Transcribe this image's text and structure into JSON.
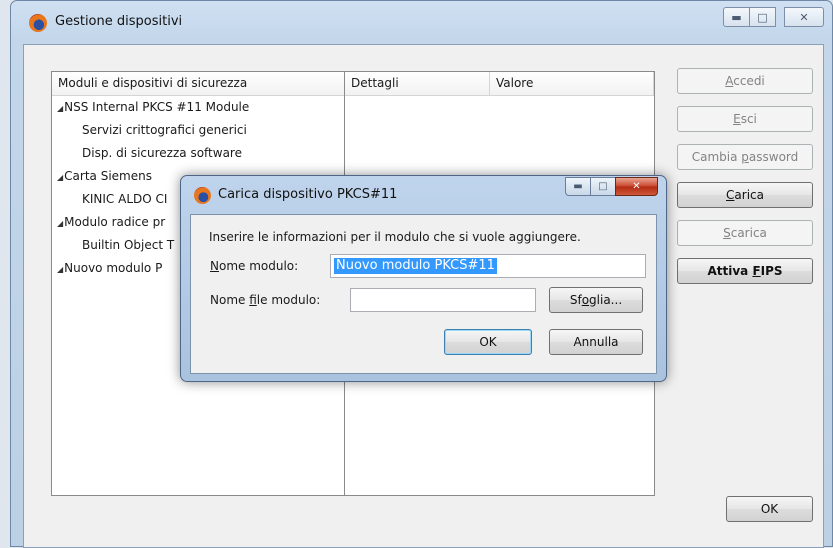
{
  "window": {
    "title": "Gestione dispositivi",
    "controls": [
      "minimize",
      "maximize",
      "close"
    ]
  },
  "tree": {
    "header": "Moduli e dispositivi di sicurezza",
    "items": [
      {
        "label": "NSS Internal PKCS #11 Module",
        "level": 0
      },
      {
        "label": "Servizi crittografici generici",
        "level": 1
      },
      {
        "label": "Disp. di sicurezza software",
        "level": 1
      },
      {
        "label": "Carta Siemens",
        "level": 0
      },
      {
        "label": "KINIC ALDO CI",
        "level": 1
      },
      {
        "label": "Modulo radice pr",
        "level": 0
      },
      {
        "label": "Builtin Object T",
        "level": 1
      },
      {
        "label": "Nuovo modulo P",
        "level": 0
      }
    ]
  },
  "details": {
    "col_details": "Dettagli",
    "col_value": "Valore"
  },
  "side_buttons": {
    "login_pre": "",
    "login_key": "A",
    "login_post": "ccedi",
    "logout_pre": "",
    "logout_key": "E",
    "logout_post": "sci",
    "password_pre": "Cambia ",
    "password_key": "p",
    "password_post": "assword",
    "load_pre": "",
    "load_key": "C",
    "load_post": "arica",
    "unload_pre": "",
    "unload_key": "S",
    "unload_post": "carica",
    "fips_pre": "Attiva ",
    "fips_key": "F",
    "fips_post": "IPS",
    "ok": "OK"
  },
  "dialog": {
    "title": "Carica dispositivo PKCS#11",
    "message": "Inserire le informazioni per il modulo che si vuole aggiungere.",
    "module_name_pre": "",
    "module_name_key": "N",
    "module_name_post": "ome modulo:",
    "module_name_value": "Nuovo modulo PKCS#11",
    "module_file_pre": "Nome ",
    "module_file_key": "f",
    "module_file_post": "ile modulo:",
    "module_file_value": "",
    "browse_pre": "Sf",
    "browse_key": "o",
    "browse_post": "glia...",
    "ok": "OK",
    "cancel": "Annulla"
  }
}
